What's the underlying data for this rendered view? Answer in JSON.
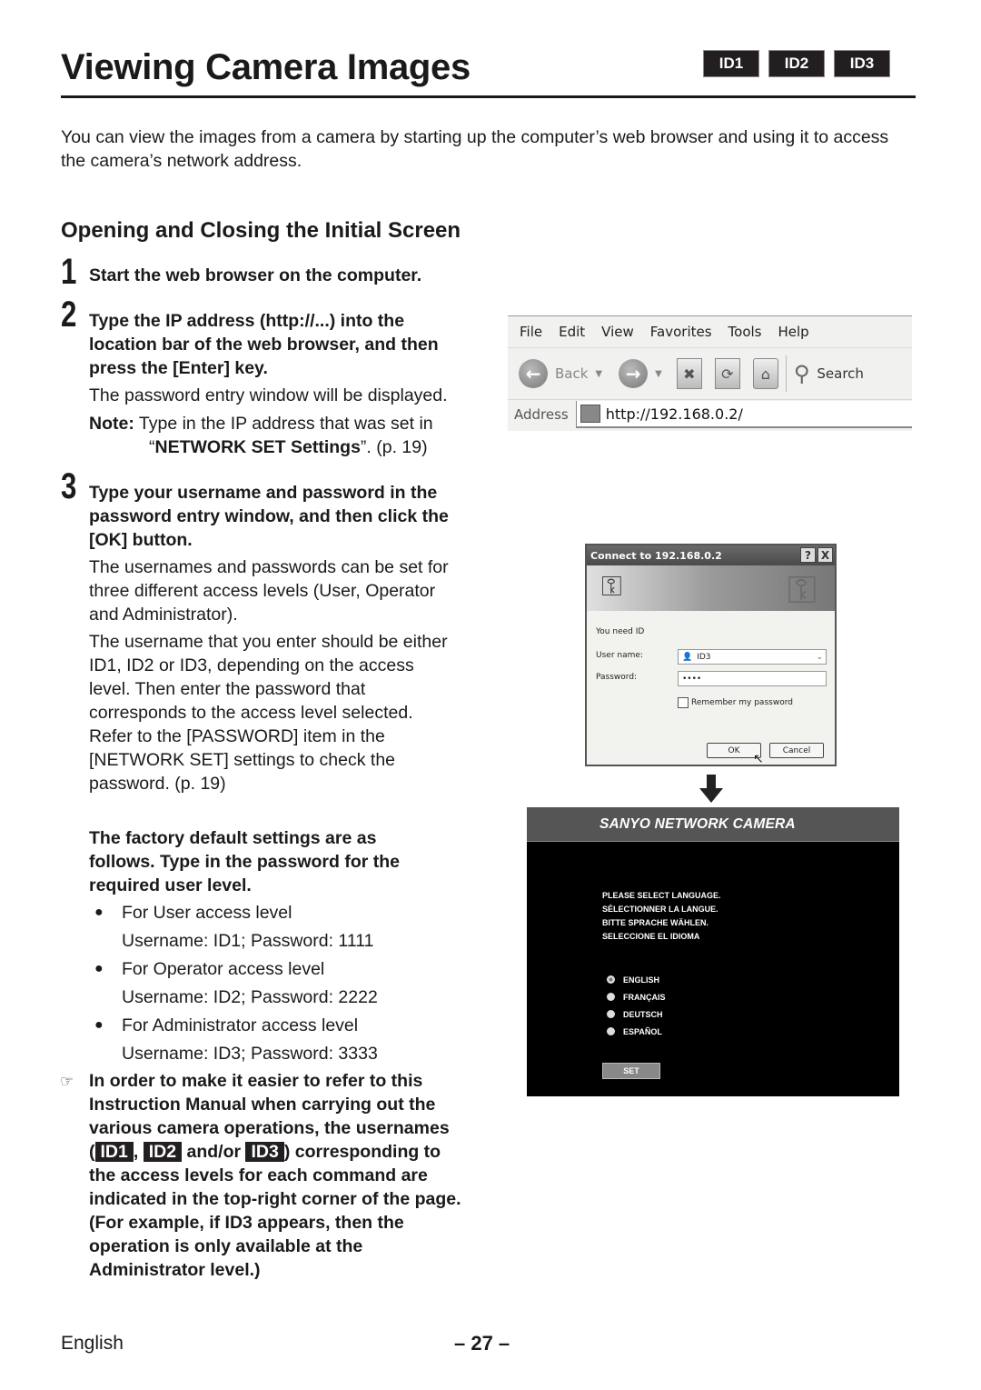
{
  "header": {
    "title": "Viewing Camera Images",
    "id_badges": [
      "ID1",
      "ID2",
      "ID3"
    ]
  },
  "intro": "You can view the images from a camera by starting up the computer’s web browser and using it to access the camera’s network address.",
  "section": {
    "heading": "Opening and Closing the Initial Screen"
  },
  "steps": [
    {
      "number": "1",
      "instruction": "Start the web browser on the computer."
    },
    {
      "number": "2",
      "instruction": "Type the IP address (http://...) into the location bar of the web browser, and then press the [Enter] key.",
      "detail": "The password entry window will be displayed.",
      "note_label": "Note:",
      "note_text_1": "Type in the IP address that was set in",
      "note_quote_open": "“",
      "note_bold": "NETWORK SET Settings",
      "note_text_2": "”. (p. 19)"
    },
    {
      "number": "3",
      "instruction": "Type your username and password in the password entry window, and then click the [OK] button.",
      "detail_1": "The usernames and passwords can be set for three different access levels (User, Operator and Administrator).",
      "detail_2": "The username that you enter should be either ID1, ID2 or ID3, depending on the access level. Then enter the password that corresponds to the access level selected. Refer to the [PASSWORD] item in the [NETWORK SET] settings to check the password. (p. 19)"
    }
  ],
  "defaults": {
    "intro": "The factory default settings are as follows. Type in the password for the required user level.",
    "levels": [
      {
        "label": "For User access level",
        "credentials": "Username: ID1; Password: 1111"
      },
      {
        "label": "For Operator access level",
        "credentials": "Username: ID2; Password: 2222"
      },
      {
        "label": "For Administrator access level",
        "credentials": "Username: ID3; Password: 3333"
      }
    ]
  },
  "tip": {
    "icon": "pointing-hand-icon",
    "text_1": "In order to make it easier to refer to this Instruction Manual when carrying out the various camera operations, the usernames (",
    "id1": "ID1",
    "sep1": ", ",
    "id2": "ID2",
    "sep2": " and/or ",
    "id3": "ID3",
    "text_2": ") corresponding to the access levels for each command are indicated in the top-right corner of the page. (For example, if ID3 appears, then the operation is only available at the Administrator level.)"
  },
  "browser": {
    "menu": [
      "File",
      "Edit",
      "View",
      "Favorites",
      "Tools",
      "Help"
    ],
    "back_label": "Back",
    "search_label": "Search",
    "address_label": "Address",
    "address_value": "http://192.168.0.2/"
  },
  "login_dialog": {
    "title": "Connect to 192.168.0.2",
    "help_btn": "?",
    "close_btn": "X",
    "prompt": "You need ID",
    "username_label": "User name:",
    "username_value": "ID3",
    "password_label": "Password:",
    "password_value": "••••",
    "remember_label": "Remember my password",
    "ok_label": "OK",
    "cancel_label": "Cancel"
  },
  "camera_screen": {
    "header": "SANYO NETWORK CAMERA",
    "prompts": [
      "PLEASE SELECT LANGUAGE.",
      "SÉLECTIONNER LA LANGUE.",
      "BITTE SPRACHE WÄHLEN.",
      "SELECCIONE EL IDIOMA"
    ],
    "languages": [
      "ENGLISH",
      "FRANÇAIS",
      "DEUTSCH",
      "ESPAÑOL"
    ],
    "selected_language": "ENGLISH",
    "set_label": "SET"
  },
  "footer": {
    "language": "English",
    "page": "– 27 –"
  }
}
